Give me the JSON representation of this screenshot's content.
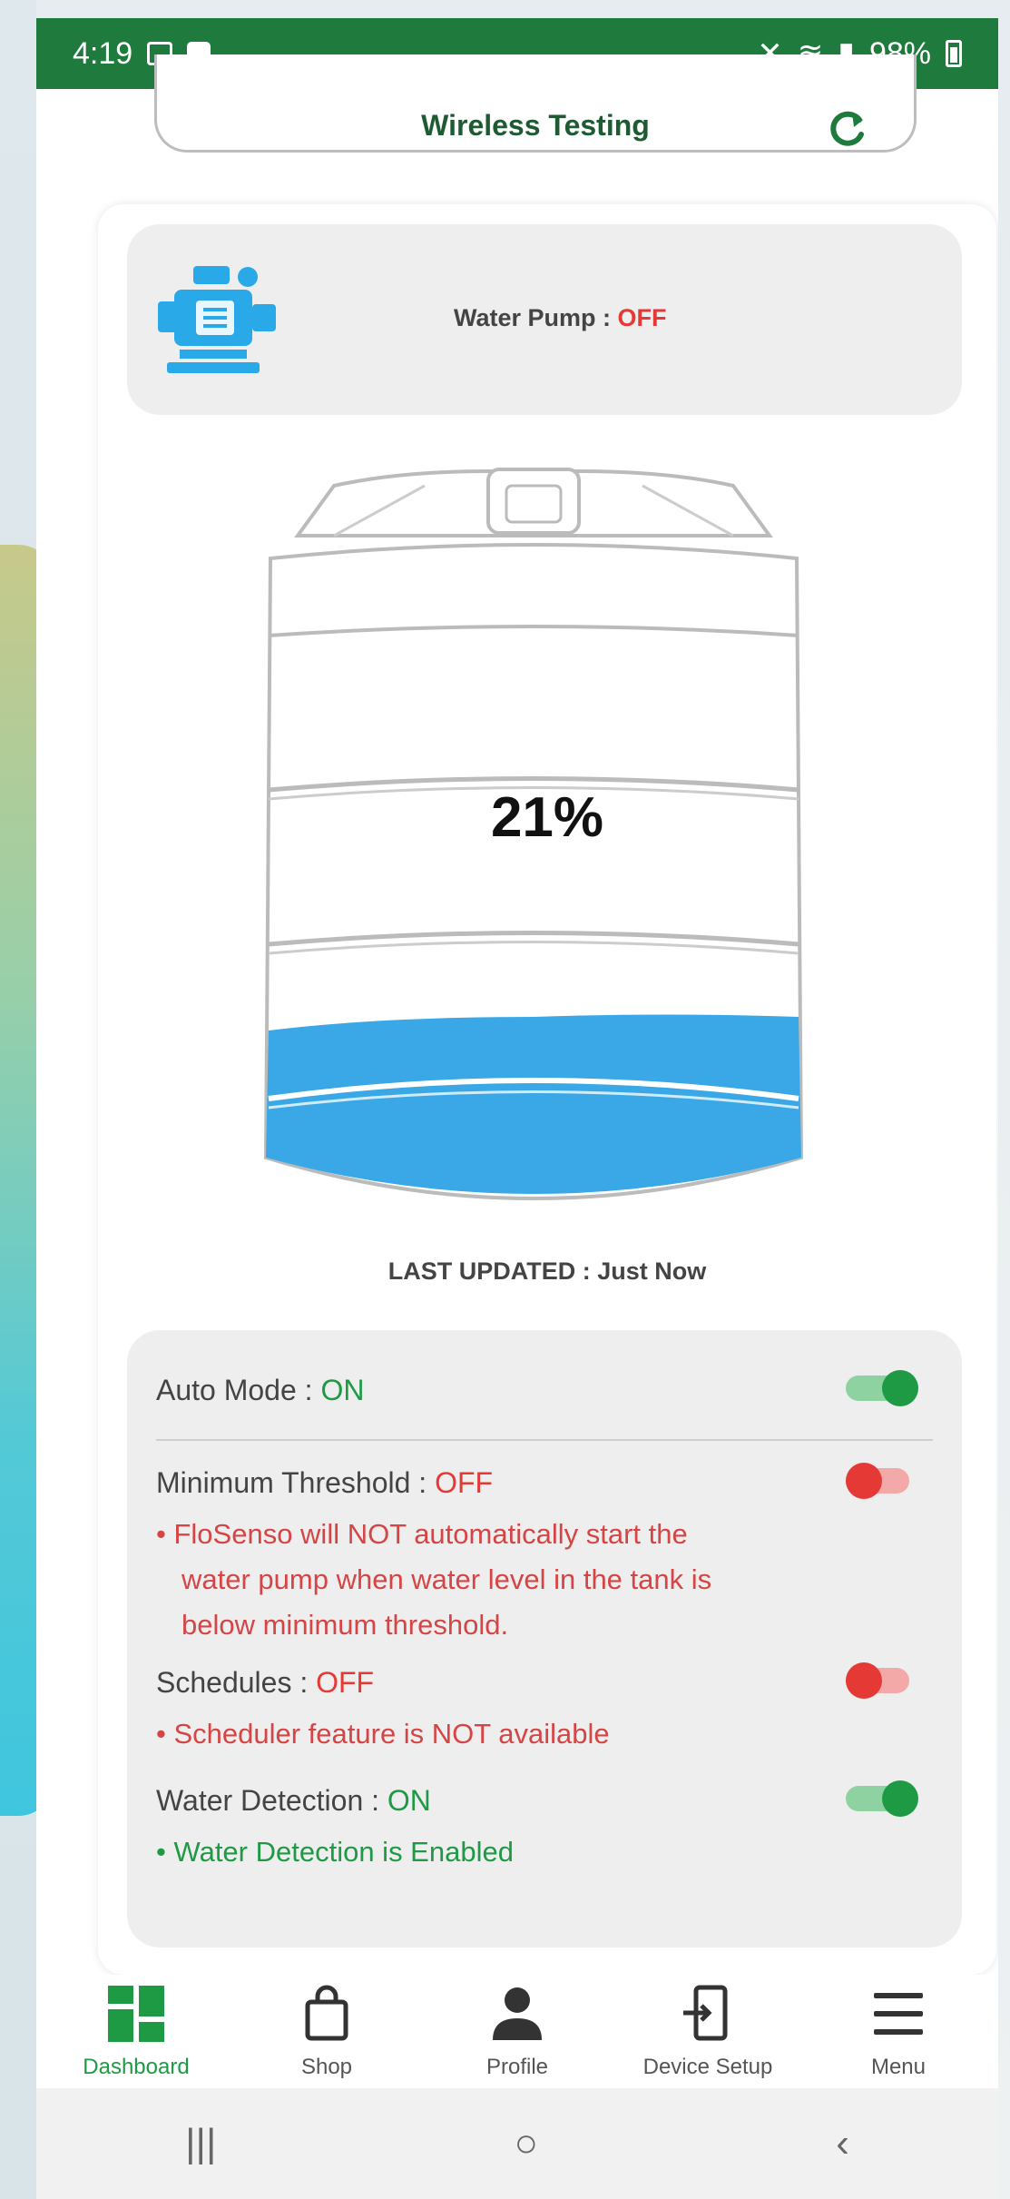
{
  "status_bar": {
    "time": "4:19",
    "battery_percent": "98%"
  },
  "header": {
    "title": "Wireless Testing"
  },
  "pump": {
    "label": "Water Pump :",
    "status": "OFF"
  },
  "tank": {
    "level_text": "21%",
    "level_fraction": 0.21
  },
  "last_updated": {
    "label": "LAST UPDATED :",
    "value": "Just Now"
  },
  "settings": {
    "auto_mode": {
      "label": "Auto Mode :",
      "status": "ON"
    },
    "min_threshold": {
      "label": "Minimum Threshold :",
      "status": "OFF",
      "note_line1": "• FloSenso will NOT automatically start the",
      "note_line2": "water pump when water level in the tank is",
      "note_line3": "below minimum threshold."
    },
    "schedules": {
      "label": "Schedules :",
      "status": "OFF",
      "note": "• Scheduler feature is NOT available"
    },
    "water_detection": {
      "label": "Water Detection :",
      "status": "ON",
      "note": "• Water Detection is Enabled"
    }
  },
  "nav": {
    "dashboard": "Dashboard",
    "shop": "Shop",
    "profile": "Profile",
    "device_setup": "Device Setup",
    "menu": "Menu"
  },
  "colors": {
    "brand_green": "#1e7a3d",
    "on_green": "#1e9a45",
    "off_red": "#e53935",
    "water_blue": "#3aa8e6"
  }
}
